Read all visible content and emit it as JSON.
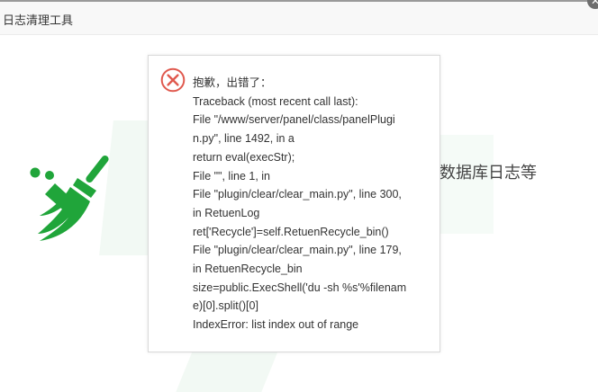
{
  "window": {
    "title": "日志清理工具"
  },
  "background": {
    "description_text": "数据库日志等"
  },
  "error_dialog": {
    "heading": "抱歉，出错了：",
    "lines": [
      "Traceback (most recent call last):",
      "File \"/www/server/panel/class/panelPlugi",
      "n.py\", line 1492, in a",
      "return eval(execStr);",
      "File \"\", line 1, in",
      "File \"plugin/clear/clear_main.py\", line 300,",
      "in RetuenLog",
      "ret['Recycle']=self.RetuenRecycle_bin()",
      "File \"plugin/clear/clear_main.py\", line 179,",
      "in RetuenRecycle_bin",
      "size=public.ExecShell('du -sh %s'%filenam",
      "e)[0].split()[0]",
      "IndexError: list index out of range"
    ]
  },
  "icons": {
    "error": "close-circle-icon",
    "tool": "broom-icon",
    "close": "close-icon"
  },
  "colors": {
    "brand_green": "#20a53a",
    "error_red": "#e0594e"
  }
}
